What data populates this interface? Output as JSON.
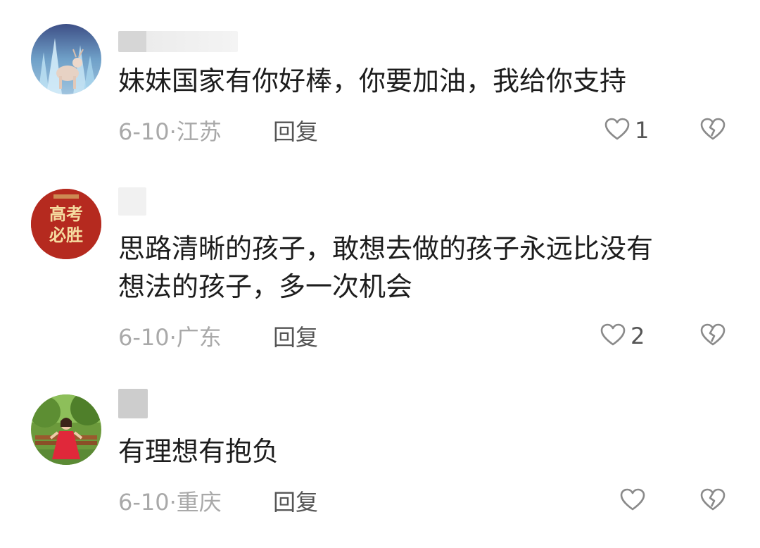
{
  "comments": [
    {
      "text": "妹妹国家有你好棒，你要加油，我给你支持",
      "date": "6-10·",
      "location": "江苏",
      "reply_label": "回复",
      "like_count": "1",
      "avatar": "ice-castle-avatar"
    },
    {
      "text": "思路清晰的孩子，敢想去做的孩子永远比没有\n想法的孩子，多一次机会",
      "date": "6-10·",
      "location": "广东",
      "reply_label": "回复",
      "like_count": "2",
      "avatar": "gaokao-bisheng-avatar",
      "avatar_text": "高考\n必胜"
    },
    {
      "text": "有理想有抱负",
      "date": "6-10·",
      "location": "重庆",
      "reply_label": "回复",
      "like_count": "",
      "avatar": "woman-in-red-dress-avatar"
    }
  ],
  "colors": {
    "meta": "#a9a9a9",
    "reply": "#555555",
    "text": "#1d1d1d",
    "icon": "#8a8a8a"
  }
}
